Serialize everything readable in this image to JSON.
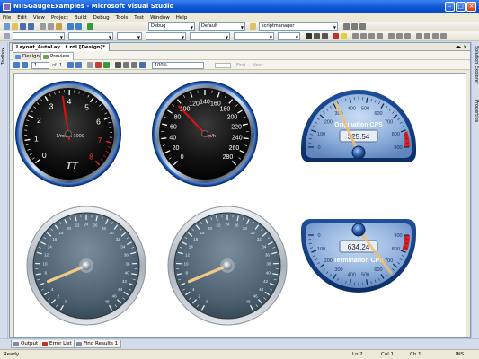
{
  "window": {
    "title": "NIISGaugeExamples - Microsoft Visual Studio",
    "icon": "vs-app-icon"
  },
  "menu": [
    "File",
    "Edit",
    "View",
    "Project",
    "Build",
    "Debug",
    "Tools",
    "Test",
    "Window",
    "Help"
  ],
  "toolbar": {
    "config": "Debug",
    "platform": "Default",
    "find": "scriptmanager",
    "font_name": "",
    "font_size": ""
  },
  "left_dock": {
    "label": "Toolbox"
  },
  "right_dock": {
    "labels": [
      "Solution Explorer",
      "Properties"
    ]
  },
  "document": {
    "tab": "Layout_AutoLay...t.rdl [Design]*",
    "design_tabs": [
      "Design",
      "Preview"
    ],
    "active_design_tab": "Preview"
  },
  "report_toolbar": {
    "page": "1",
    "of_label": "of",
    "total": "1",
    "zoom": "100%",
    "find_label": "Find",
    "next_label": "Next"
  },
  "gauges": {
    "tach": {
      "labels": [
        "0",
        "1",
        "2",
        "3",
        "4",
        "5",
        "6",
        "7",
        "8"
      ],
      "caption": "1/min x 1000",
      "logo": "TT",
      "value": 3.7
    },
    "speedo": {
      "labels": [
        "0",
        "20",
        "40",
        "60",
        "80",
        "100",
        "120",
        "140",
        "160",
        "180",
        "200",
        "220",
        "240",
        "260",
        "280"
      ],
      "caption": "km/h",
      "value": 95
    },
    "origination": {
      "labels": [
        "0",
        "100",
        "200",
        "300",
        "400",
        "500",
        "600",
        "700",
        "800",
        "900"
      ],
      "title": "Origination CPS",
      "readout": "325.54",
      "value": 325.54
    },
    "termination": {
      "labels": [
        "0",
        "100",
        "200",
        "300",
        "400",
        "500",
        "600",
        "700",
        "800",
        "900"
      ],
      "title": "Termination CPS",
      "readout": "634.24",
      "value": 634.24
    },
    "dial_labels": [
      "0",
      "2",
      "4",
      "6",
      "8",
      "10",
      "12",
      "14",
      "16",
      "18",
      "20",
      "22",
      "24",
      "26",
      "28",
      "30",
      "32",
      "34",
      "36",
      "38",
      "40",
      "42",
      "44",
      "46",
      "48"
    ],
    "dial1_value": 6,
    "dial2_value": 6
  },
  "bottom_tabs": [
    "Output",
    "Error List",
    "Find Results 1"
  ],
  "status": {
    "ready": "Ready",
    "line": "Ln 2",
    "col": "Col 1",
    "ch": "Ch 1",
    "mode": "INS"
  }
}
